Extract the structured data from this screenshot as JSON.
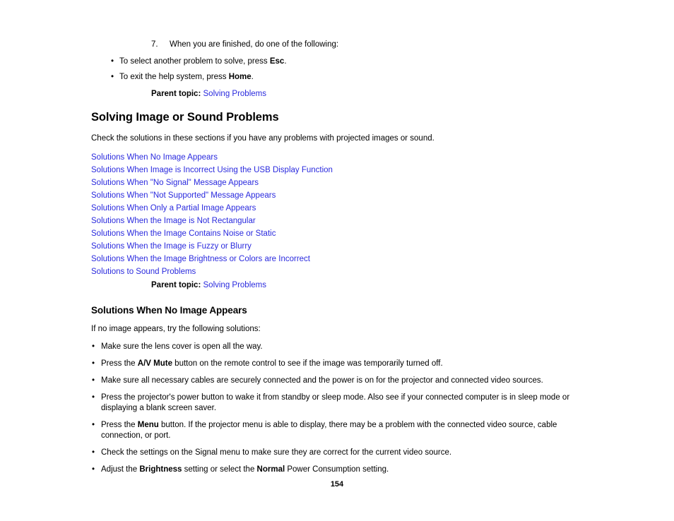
{
  "page": {
    "number": "154"
  },
  "step": {
    "number": "7.",
    "text": "When you are finished, do one of the following:",
    "bullet_glyph": "•",
    "substeps": [
      {
        "before": "To select another problem to solve, press ",
        "key": "Esc",
        "after": "."
      },
      {
        "before": "To exit the help system, press ",
        "key": "Home",
        "after": "."
      }
    ]
  },
  "parent_topic_top": {
    "label": "Parent topic:",
    "link": "Solving Problems"
  },
  "section": {
    "title": "Solving Image or Sound Problems",
    "intro": "Check the solutions in these sections if you have any problems with projected images or sound.",
    "links": [
      "Solutions When No Image Appears",
      "Solutions When Image is Incorrect Using the USB Display Function",
      "Solutions When \"No Signal\" Message Appears",
      "Solutions When \"Not Supported\" Message Appears",
      "Solutions When Only a Partial Image Appears",
      "Solutions When the Image is Not Rectangular",
      "Solutions When the Image Contains Noise or Static",
      "Solutions When the Image is Fuzzy or Blurry",
      "Solutions When the Image Brightness or Colors are Incorrect",
      "Solutions to Sound Problems"
    ],
    "parent_topic": {
      "label": "Parent topic:",
      "link": "Solving Problems"
    }
  },
  "subsection": {
    "title": "Solutions When No Image Appears",
    "intro": "If no image appears, try the following solutions:",
    "bullet_glyph": "•",
    "bullets": [
      {
        "p1": "Make sure the lens cover is open all the way.",
        "b1": "",
        "p2": "",
        "b2": "",
        "p3": ""
      },
      {
        "p1": "Press the ",
        "b1": "A/V Mute",
        "p2": " button on the remote control to see if the image was temporarily turned off.",
        "b2": "",
        "p3": ""
      },
      {
        "p1": "Make sure all necessary cables are securely connected and the power is on for the projector and connected video sources.",
        "b1": "",
        "p2": "",
        "b2": "",
        "p3": ""
      },
      {
        "p1": "Press the projector's power button to wake it from standby or sleep mode. Also see if your connected computer is in sleep mode or displaying a blank screen saver.",
        "b1": "",
        "p2": "",
        "b2": "",
        "p3": ""
      },
      {
        "p1": "Press the ",
        "b1": "Menu",
        "p2": " button. If the projector menu is able to display, there may be a problem with the connected video source, cable connection, or port.",
        "b2": "",
        "p3": ""
      },
      {
        "p1": "Check the settings on the Signal menu to make sure they are correct for the current video source.",
        "b1": "",
        "p2": "",
        "b2": "",
        "p3": ""
      },
      {
        "p1": "Adjust the ",
        "b1": "Brightness",
        "p2": " setting or select the ",
        "b2": "Normal",
        "p3": " Power Consumption setting."
      }
    ]
  },
  "colors": {
    "link": "#2A2ADE",
    "text": "#000000",
    "background": "#FFFFFF"
  }
}
